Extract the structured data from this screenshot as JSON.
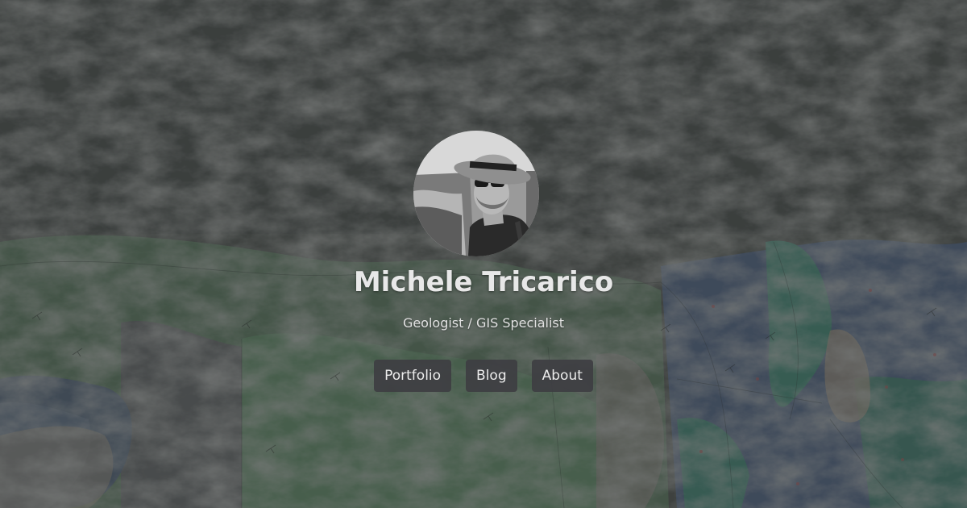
{
  "profile": {
    "name": "Michele Tricarico",
    "subtitle": "Geologist / GIS Specialist"
  },
  "nav": {
    "items": [
      {
        "label": "Portfolio"
      },
      {
        "label": "Blog"
      },
      {
        "label": "About"
      }
    ]
  },
  "theme": {
    "text_color": "#e8e8e8",
    "button_bg": "#3e3e42",
    "bg_dark": "#3d423f",
    "bg_green": "#4f6a55",
    "bg_blue": "#485a72",
    "bg_teal": "#3f7a6a"
  }
}
